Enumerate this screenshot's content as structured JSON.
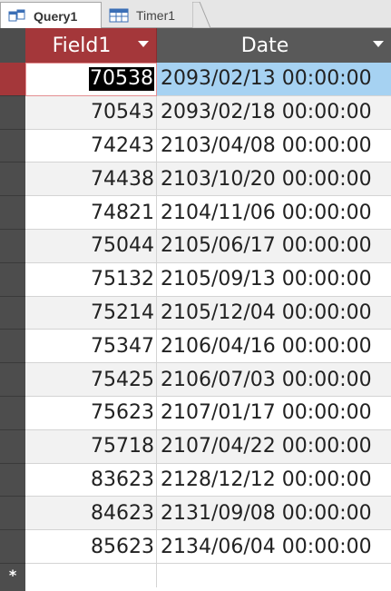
{
  "tabs": [
    {
      "label": "Query1",
      "icon": "query-icon",
      "active": true
    },
    {
      "label": "Timer1",
      "icon": "table-icon",
      "active": false
    }
  ],
  "columns": {
    "field1": "Field1",
    "date": "Date"
  },
  "rows": [
    {
      "field1": "70538",
      "date": "2093/02/13 00:00:00"
    },
    {
      "field1": "70543",
      "date": "2093/02/18 00:00:00"
    },
    {
      "field1": "74243",
      "date": "2103/04/08 00:00:00"
    },
    {
      "field1": "74438",
      "date": "2103/10/20 00:00:00"
    },
    {
      "field1": "74821",
      "date": "2104/11/06 00:00:00"
    },
    {
      "field1": "75044",
      "date": "2105/06/17 00:00:00"
    },
    {
      "field1": "75132",
      "date": "2105/09/13 00:00:00"
    },
    {
      "field1": "75214",
      "date": "2105/12/04 00:00:00"
    },
    {
      "field1": "75347",
      "date": "2106/04/16 00:00:00"
    },
    {
      "field1": "75425",
      "date": "2106/07/03 00:00:00"
    },
    {
      "field1": "75623",
      "date": "2107/01/17 00:00:00"
    },
    {
      "field1": "75718",
      "date": "2107/04/22 00:00:00"
    },
    {
      "field1": "83623",
      "date": "2128/12/12 00:00:00"
    },
    {
      "field1": "84623",
      "date": "2131/09/08 00:00:00"
    },
    {
      "field1": "85623",
      "date": "2134/06/04 00:00:00"
    }
  ],
  "new_record_marker": "*",
  "colors": {
    "accent": "#a4373a",
    "selection": "#a6d2f2",
    "selector": "#4d4d4d"
  }
}
